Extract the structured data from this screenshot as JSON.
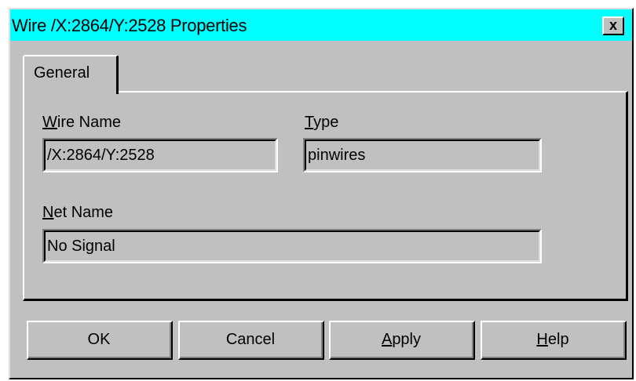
{
  "window": {
    "title": "Wire /X:2864/Y:2528 Properties",
    "close_label": "x"
  },
  "tabs": [
    {
      "label": "General"
    }
  ],
  "fields": {
    "wire_name": {
      "mnemonic": "W",
      "label_rest": "ire Name",
      "value": "/X:2864/Y:2528"
    },
    "type": {
      "mnemonic": "T",
      "label_rest": "ype",
      "value": "pinwires"
    },
    "net_name": {
      "mnemonic": "N",
      "label_rest": "et Name",
      "value": "No Signal"
    }
  },
  "buttons": {
    "ok": "OK",
    "cancel": "Cancel",
    "apply": {
      "mnemonic": "A",
      "rest": "pply"
    },
    "help": {
      "mnemonic": "H",
      "rest": "elp"
    }
  },
  "colors": {
    "titlebar": "#00ffff",
    "dialog_face": "#c0c0c0"
  }
}
